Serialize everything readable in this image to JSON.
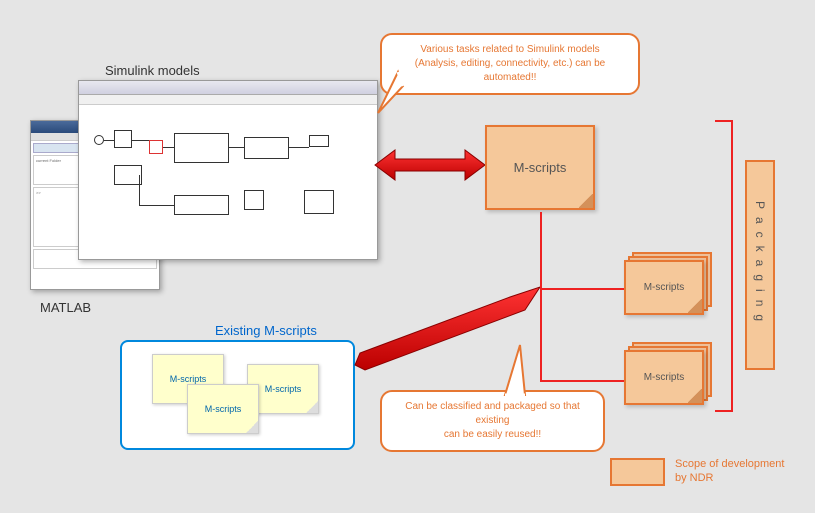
{
  "labels": {
    "simulink": "Simulink models",
    "matlab": "MATLAB",
    "existing": "Existing M-scripts"
  },
  "bubble1": {
    "line1": "Various tasks related to Simulink models",
    "line2": "(Analysis, editing, connectivity, etc.) can be automated!!"
  },
  "bubble2": {
    "line1": "Can be classified and packaged so that existing",
    "line2": "can be easily reused!!"
  },
  "sticky": {
    "a": "M-scripts",
    "b": "M-scripts",
    "c": "M-scripts"
  },
  "mscript": {
    "main": "M-scripts",
    "sub1": "M-scripts",
    "sub2": "M-scripts"
  },
  "packaging": "Packaging",
  "legend": {
    "line1": "Scope of development",
    "line2": "by NDR"
  }
}
